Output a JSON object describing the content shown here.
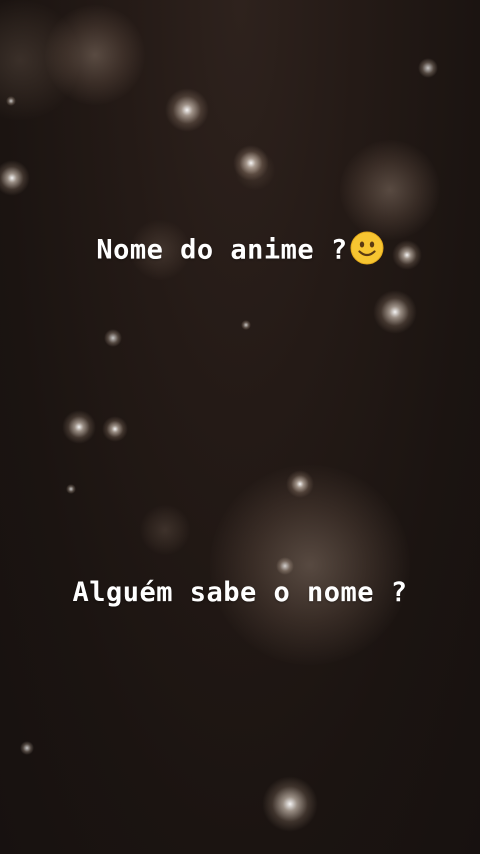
{
  "captions": {
    "title": "Nome do anime ?",
    "question": "Alguém sabe o nome ?"
  },
  "icons": {
    "title_emoji": "slightly-smiling-face-icon"
  },
  "colors": {
    "background": "#1b1411",
    "text": "#ffffff",
    "emoji_face": "#f7c531"
  }
}
